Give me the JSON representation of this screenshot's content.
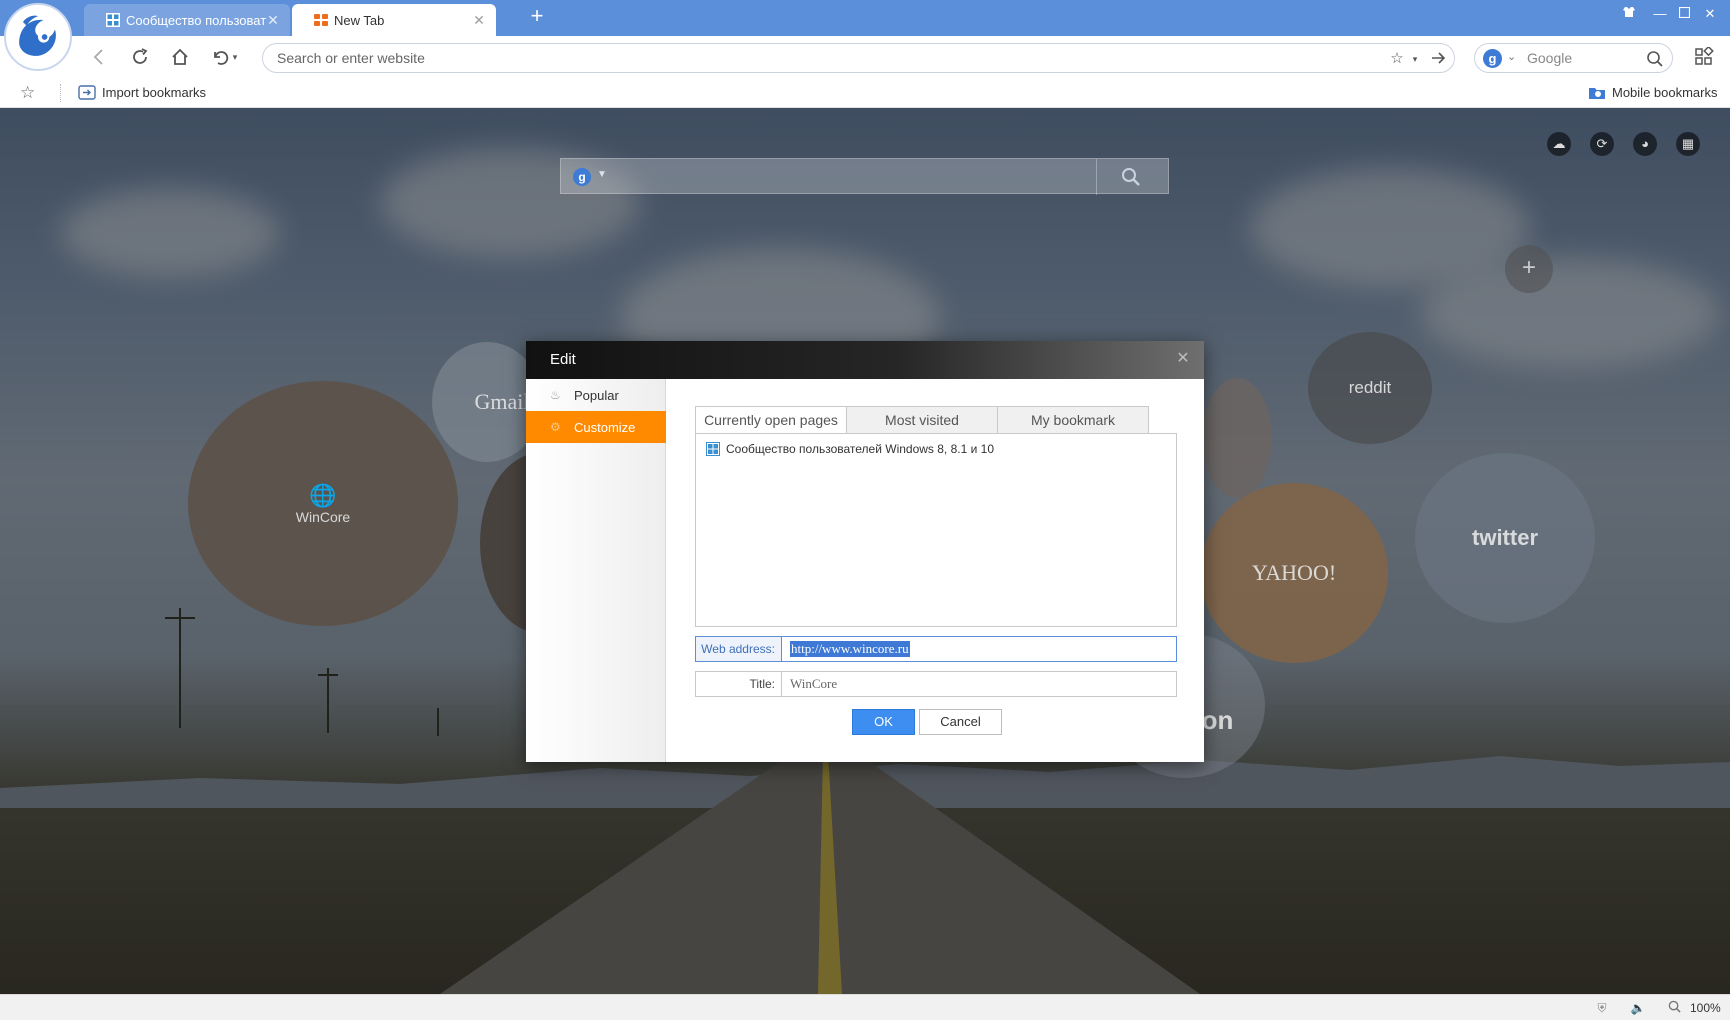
{
  "tabs": [
    {
      "title": "Сообщество пользовател",
      "active": false
    },
    {
      "title": "New Tab",
      "active": true
    }
  ],
  "toolbar": {
    "address_placeholder": "Search or enter website",
    "search_engine_placeholder": "Google"
  },
  "bookmarks_bar": {
    "import_label": "Import bookmarks",
    "mobile_label": "Mobile bookmarks"
  },
  "newtab": {
    "speed_dials": [
      {
        "label": "WinCore"
      },
      {
        "label": "reddit"
      },
      {
        "label": "twitter"
      },
      {
        "label": "YAHOO!"
      },
      {
        "label": "amazon"
      },
      {
        "label": "Gmail"
      }
    ]
  },
  "dialog": {
    "title": "Edit",
    "sidebar": [
      {
        "label": "Popular",
        "selected": false
      },
      {
        "label": "Customize",
        "selected": true
      }
    ],
    "tabs": [
      {
        "label": "Currently open pages",
        "selected": true
      },
      {
        "label": "Most visited",
        "selected": false
      },
      {
        "label": "My bookmark",
        "selected": false
      }
    ],
    "pages": [
      {
        "title": "Сообщество пользователей Windows 8, 8.1 и 10"
      }
    ],
    "web_address_label": "Web address:",
    "web_address_value": "http://www.wincore.ru",
    "title_label": "Title:",
    "title_value": "WinCore",
    "ok_label": "OK",
    "cancel_label": "Cancel"
  },
  "statusbar": {
    "zoom": "100%"
  },
  "colors": {
    "titlebar": "#5b8fd9",
    "accent_orange": "#ff8a00",
    "ok_button": "#3d8ef0",
    "selection": "#3f79d6"
  },
  "icons": [
    "uc-browser-logo",
    "back-icon",
    "reload-icon",
    "home-icon",
    "undo-icon",
    "star-icon",
    "go-arrow-icon",
    "search-icon",
    "apps-icon",
    "import-icon",
    "cloud-icon",
    "refresh-icon",
    "palette-icon",
    "grid-icon",
    "plus-icon",
    "close-icon",
    "flame-icon",
    "gear-icon",
    "windows-favicon"
  ]
}
